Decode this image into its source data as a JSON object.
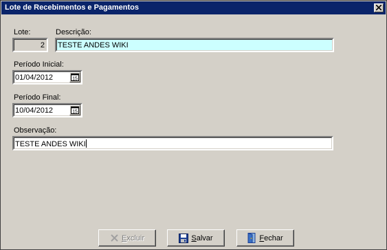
{
  "window": {
    "title": "Lote de Recebimentos e Pagamentos"
  },
  "form": {
    "lote": {
      "label": "Lote:",
      "value": "2"
    },
    "descricao": {
      "label": "Descrição:",
      "value": "TESTE ANDES WIKI"
    },
    "periodo_inicial": {
      "label": "Período Inicial:",
      "value": "01/04/2012"
    },
    "periodo_final": {
      "label": "Período Final:",
      "value": "10/04/2012"
    },
    "observacao": {
      "label": "Observação:",
      "value": "TESTE ANDES WIKI"
    },
    "calendar_icon_text": "15"
  },
  "buttons": {
    "excluir": {
      "accel": "E",
      "rest": "xcluir",
      "enabled": false,
      "icon": "x-icon"
    },
    "salvar": {
      "accel": "S",
      "rest": "alvar",
      "enabled": true,
      "icon": "floppy-disk-icon"
    },
    "fechar": {
      "accel": "F",
      "rest": "echar",
      "enabled": true,
      "icon": "door-icon"
    }
  },
  "colors": {
    "title_bar": "#0a246a",
    "highlight_field": "#ccffff",
    "face": "#d4d0c8"
  }
}
